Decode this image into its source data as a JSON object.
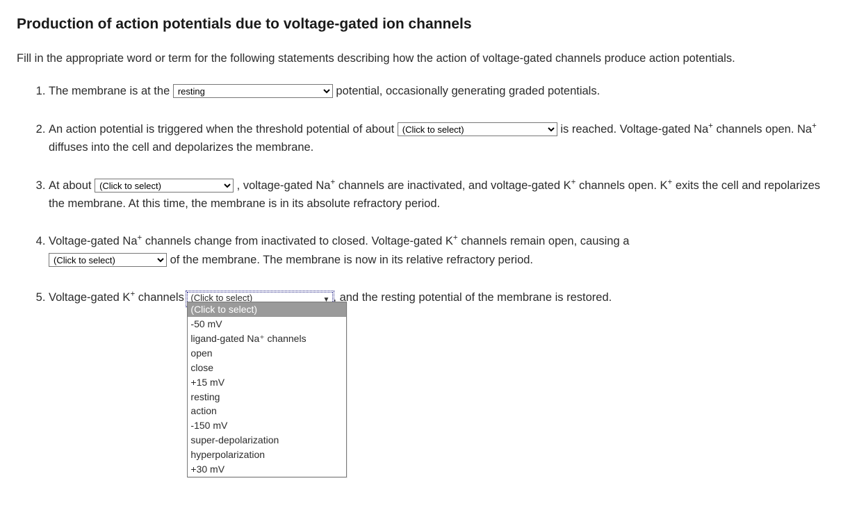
{
  "title": "Production of action potentials due to voltage-gated ion channels",
  "instructions": "Fill in the appropriate word or term for the following statements describing how the action of voltage-gated channels produce action potentials.",
  "click_to_select": "(Click to select)",
  "items": {
    "1": {
      "pre": "The membrane is at the ",
      "sel": "resting",
      "post": " potential, occasionally generating graded potentials."
    },
    "2": {
      "pre": "An action potential is triggered when the threshold potential of about ",
      "post_a": " is reached. Voltage-gated ",
      "na1": "Na",
      "post_b": " channels open. ",
      "na2": "Na",
      "post_c": " diffuses into the cell and depolarizes the membrane."
    },
    "3": {
      "pre": "At about ",
      "post_a": " , voltage-gated ",
      "na": "Na",
      "post_b": " channels are inactivated, and voltage-gated ",
      "k": "K",
      "post_c": " channels open. ",
      "k2": "K",
      "post_d": " exits the cell and repolarizes the membrane. At this time, the membrane is in its absolute refractory period."
    },
    "4": {
      "pre_a": "Voltage-gated ",
      "na": "Na",
      "pre_b": " channels change from inactivated to closed. Voltage-gated ",
      "k": "K",
      "pre_c": " channels remain open, causing a ",
      "post": " of the membrane. The membrane is now in its relative refractory period."
    },
    "5": {
      "pre_a": "Voltage-gated ",
      "k": "K",
      "pre_b": " channels ",
      "post": ", and the resting potential of the membrane is restored."
    }
  },
  "dropdown_options": [
    "(Click to select)",
    "-50 mV",
    "ligand-gated Na⁺ channels",
    "open",
    "close",
    "+15 mV",
    "resting",
    "action",
    "-150 mV",
    "super-depolarization",
    "hyperpolarization",
    "+30 mV"
  ]
}
